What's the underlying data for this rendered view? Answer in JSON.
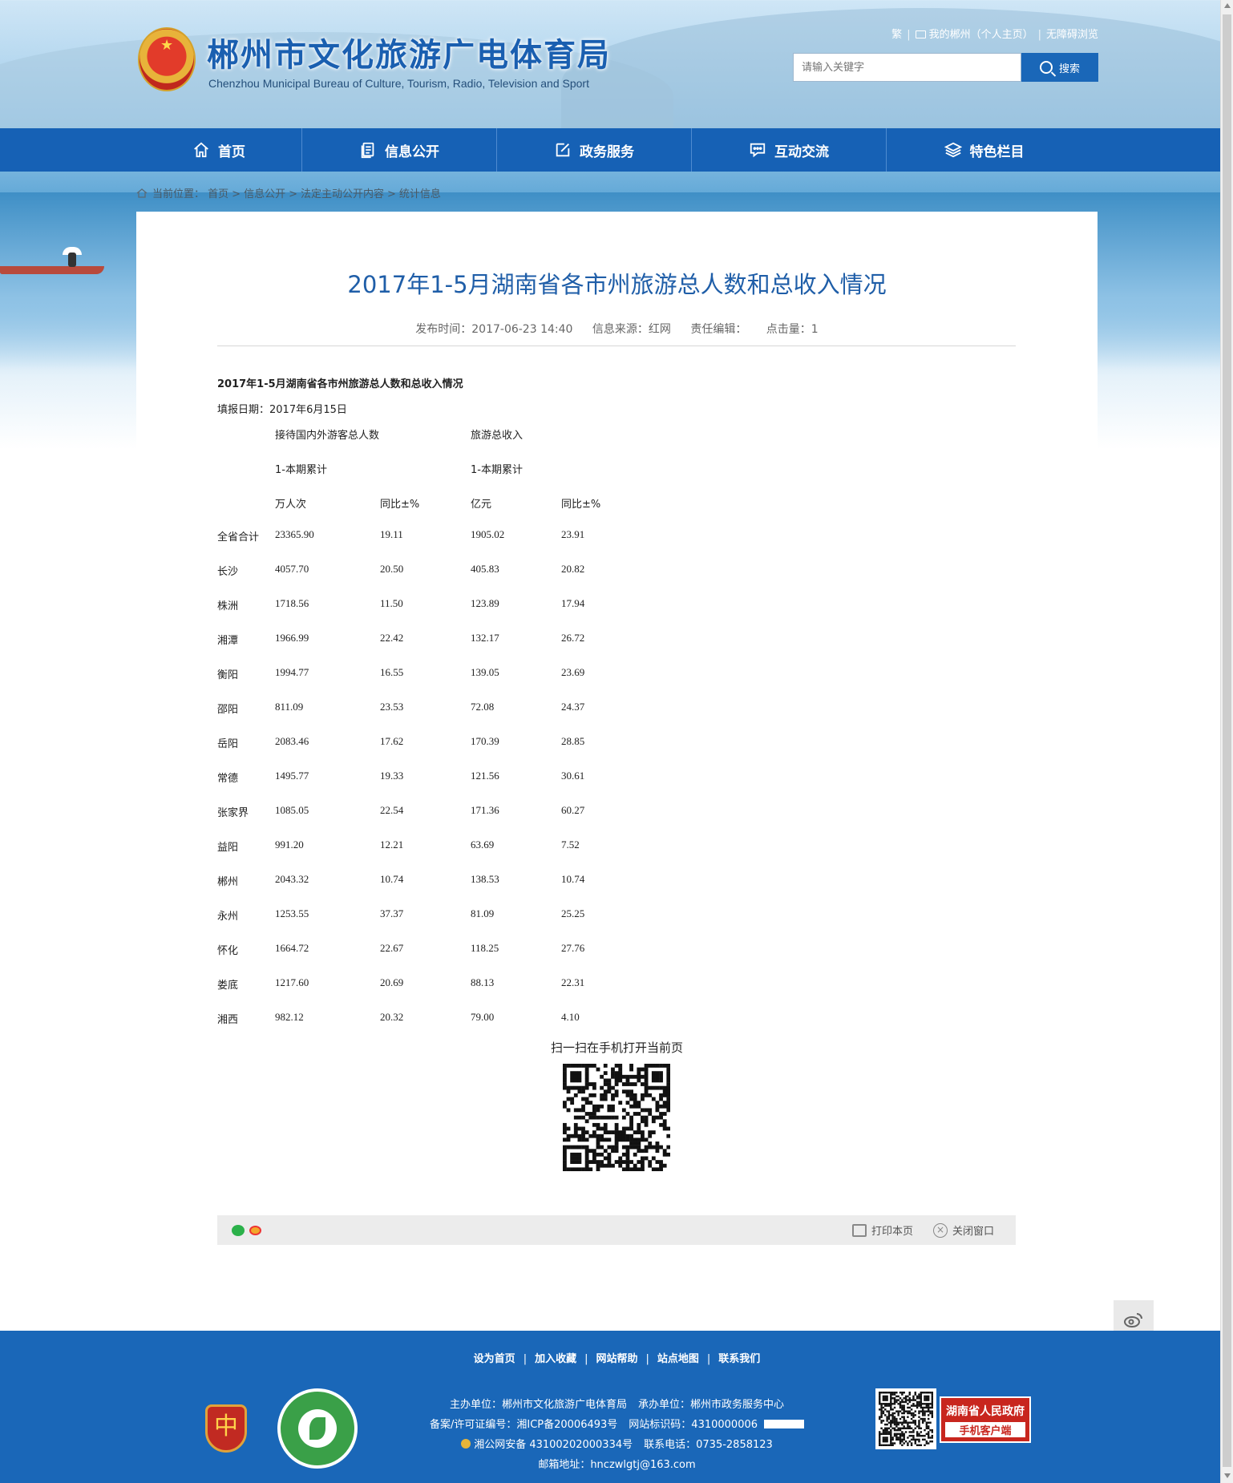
{
  "header": {
    "site_title": "郴州市文化旅游广电体育局",
    "site_subtitle": "Chenzhou Municipal Bureau of Culture, Tourism, Radio, Television and Sport",
    "top_links": [
      "繁",
      "我的郴州（个人主页）",
      "无障碍浏览"
    ],
    "search_placeholder": "请输入关键字",
    "search_label": "搜索"
  },
  "nav": [
    {
      "label": "首页",
      "icon": "home-icon"
    },
    {
      "label": "信息公开",
      "icon": "document-icon"
    },
    {
      "label": "政务服务",
      "icon": "edit-icon"
    },
    {
      "label": "互动交流",
      "icon": "chat-icon"
    },
    {
      "label": "特色栏目",
      "icon": "layers-icon"
    }
  ],
  "breadcrumb": {
    "prefix": "当前位置：",
    "items": [
      "首页",
      "信息公开",
      "法定主动公开内容",
      "统计信息"
    ]
  },
  "article": {
    "title": "2017年1-5月湖南省各市州旅游总人数和总收入情况",
    "publish_time": "发布时间：2017-06-23 14:40",
    "source": "信息来源：红网",
    "editor": "责任编辑：",
    "clicks": "点击量：1",
    "doc_heading": "2017年1-5月湖南省各市州旅游总人数和总收入情况",
    "doc_date": "填报日期：2017年6月15日",
    "col_group1": "接待国内外游客总人数",
    "col_group2": "旅游总收入",
    "period1": "1-本期累计",
    "period2": "1-本期累计",
    "unit1": "万人次",
    "yoy1": "同比±%",
    "unit2": "亿元",
    "yoy2": "同比±%"
  },
  "table": {
    "rows": [
      [
        "全省合计",
        "23365.90",
        "19.11",
        "1905.02",
        "23.91"
      ],
      [
        "长沙",
        "4057.70",
        "20.50",
        "405.83",
        "20.82"
      ],
      [
        "株洲",
        "1718.56",
        "11.50",
        "123.89",
        "17.94"
      ],
      [
        "湘潭",
        "1966.99",
        "22.42",
        "132.17",
        "26.72"
      ],
      [
        "衡阳",
        "1994.77",
        "16.55",
        "139.05",
        "23.69"
      ],
      [
        "邵阳",
        "811.09",
        "23.53",
        "72.08",
        "24.37"
      ],
      [
        "岳阳",
        "2083.46",
        "17.62",
        "170.39",
        "28.85"
      ],
      [
        "常德",
        "1495.77",
        "19.33",
        "121.56",
        "30.61"
      ],
      [
        "张家界",
        "1085.05",
        "22.54",
        "171.36",
        "60.27"
      ],
      [
        "益阳",
        "991.20",
        "12.21",
        "63.69",
        "7.52"
      ],
      [
        "郴州",
        "2043.32",
        "10.74",
        "138.53",
        "10.74"
      ],
      [
        "永州",
        "1253.55",
        "37.37",
        "81.09",
        "25.25"
      ],
      [
        "怀化",
        "1664.72",
        "22.67",
        "118.25",
        "27.76"
      ],
      [
        "娄底",
        "1217.60",
        "20.69",
        "88.13",
        "22.31"
      ],
      [
        "湘西",
        "982.12",
        "20.32",
        "79.00",
        "4.10"
      ]
    ]
  },
  "qr": {
    "label": "扫一扫在手机打开当前页"
  },
  "sharebar": {
    "print_label": "打印本页",
    "close_label": "关闭窗口"
  },
  "footer": {
    "links": [
      "设为首页",
      "加入收藏",
      "网站帮助",
      "站点地图",
      "联系我们"
    ],
    "sponsor": "主办单位：郴州市文化旅游广电体育局",
    "organizer": "承办单位：郴州市政务服务中心",
    "icp": "备案/许可证编号：湘ICP备20006493号",
    "site_id": "网站标识码：4310000006",
    "police": "湘公网安备 43100202000334号",
    "phone": "联系电话：0735-2858123",
    "email": "邮箱地址：hnczwlgtj@163.com",
    "app_badge_line1": "湖南省人民政府",
    "app_badge_line2": "手机客户端"
  }
}
